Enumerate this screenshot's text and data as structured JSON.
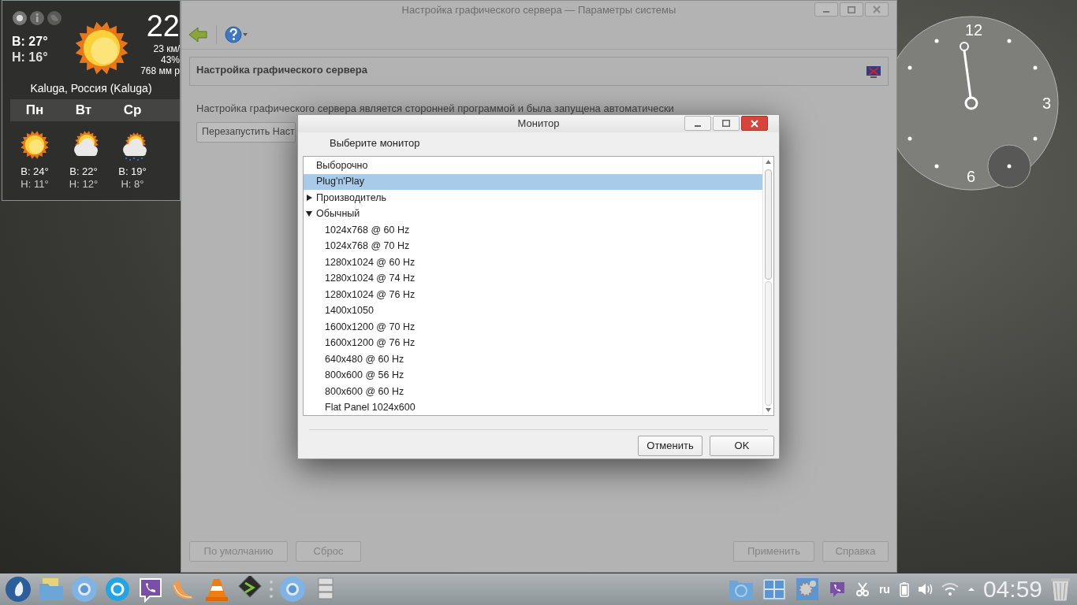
{
  "weather": {
    "temp": "22",
    "high": "В: 27°",
    "low": "Н: 16°",
    "wind": "23 км/",
    "humidity": "43%",
    "pressure": "768 мм р",
    "location": "Kaluga, Россия (Kaluga)",
    "forecast": [
      {
        "day": "Пн",
        "kind": "sunny",
        "high": "В: 24°",
        "low": "Н: 11°"
      },
      {
        "day": "Вт",
        "kind": "partly_cloudy",
        "high": "В: 22°",
        "low": "Н: 12°"
      },
      {
        "day": "Ср",
        "kind": "rain",
        "high": "В: 19°",
        "low": "Н: 8°"
      }
    ]
  },
  "clock": {
    "numerals": [
      "12",
      "3",
      "6"
    ]
  },
  "main_window": {
    "title": "Настройка графического сервера — Параметры системы",
    "header": "Настройка графического сервера",
    "message": "Настройка графического сервера является сторонней программой и была запущена автоматически",
    "restart_button": "Перезапустить Наст",
    "buttons_left": [
      "По умолчанию",
      "Сброс"
    ],
    "buttons_right": [
      "Применить",
      "Справка"
    ]
  },
  "dialog": {
    "title": "Монитор",
    "prompt": "Выберите монитор",
    "tree": [
      {
        "label": "Выборочно",
        "selected": false
      },
      {
        "label": "Plug'n'Play",
        "selected": true
      },
      {
        "label": "Производитель",
        "selected": false,
        "expanded": false
      },
      {
        "label": "Обычный",
        "selected": false,
        "expanded": true,
        "children": [
          {
            "label": "1024x768 @ 60 Hz",
            "selected": false
          },
          {
            "label": "1024x768 @ 70 Hz",
            "selected": false
          },
          {
            "label": "1280x1024 @ 60 Hz",
            "selected": false
          },
          {
            "label": "1280x1024 @ 74 Hz",
            "selected": false
          },
          {
            "label": "1280x1024 @ 76 Hz",
            "selected": false
          },
          {
            "label": "1400x1050",
            "selected": false
          },
          {
            "label": "1600x1200 @ 70 Hz",
            "selected": false
          },
          {
            "label": "1600x1200 @ 76 Hz",
            "selected": false
          },
          {
            "label": "640x480 @ 60 Hz",
            "selected": false
          },
          {
            "label": "800x600 @ 56 Hz",
            "selected": false
          },
          {
            "label": "800x600 @ 60 Hz",
            "selected": false
          },
          {
            "label": "Flat Panel 1024x600",
            "selected": false
          }
        ]
      }
    ],
    "buttons": [
      "Отменить",
      "OK"
    ]
  },
  "taskbar": {
    "keyboard_layout": "ru",
    "time": "04:59"
  }
}
